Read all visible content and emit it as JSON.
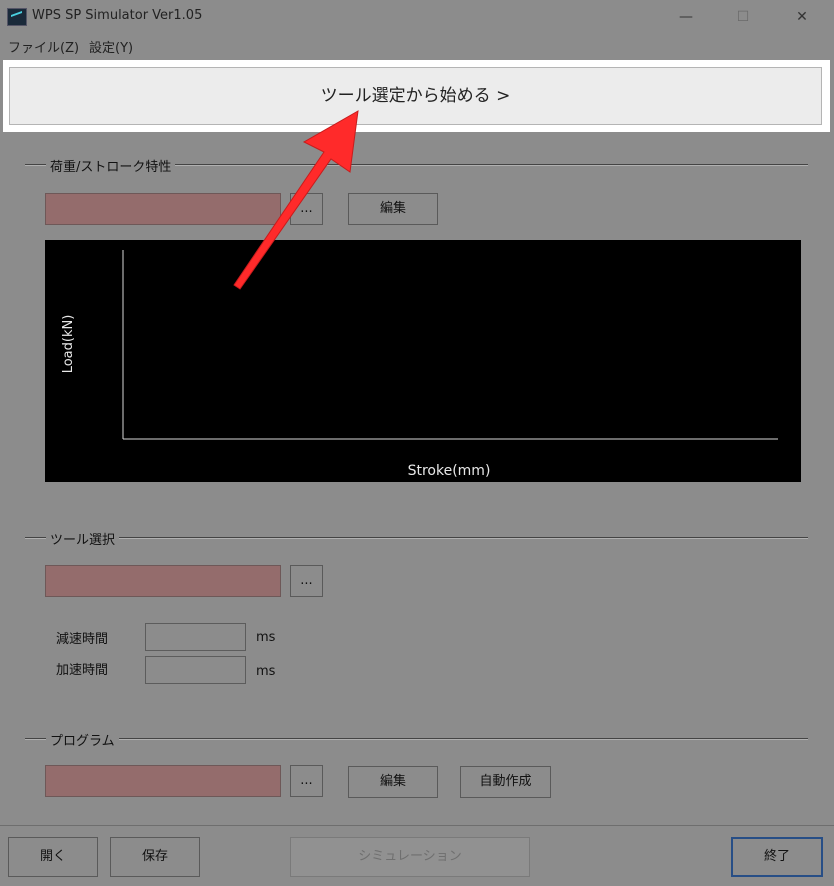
{
  "window": {
    "title": "WPS SP Simulator  Ver1.05",
    "minimize_glyph": "—",
    "maximize_glyph": "☐",
    "close_glyph": "✕"
  },
  "menu": {
    "file": "ファイル(Z)",
    "settings": "設定(Y)"
  },
  "start": {
    "label": "ツール選定から始める >"
  },
  "load_stroke": {
    "group_label": "荷重/ストローク特性",
    "browse_label": "...",
    "edit_label": "編集",
    "chart_data": {
      "type": "line",
      "xlabel": "Stroke(mm)",
      "ylabel": "Load(kN)",
      "series": []
    }
  },
  "tool": {
    "group_label": "ツール選択",
    "browse_label": "...",
    "decel_label": "減速時間",
    "decel_unit": "ms",
    "decel_value": "",
    "accel_label": "加速時間",
    "accel_unit": "ms",
    "accel_value": ""
  },
  "program": {
    "group_label": "プログラム",
    "browse_label": "...",
    "edit_label": "編集",
    "auto_label": "自動作成"
  },
  "footer": {
    "open_label": "開く",
    "save_label": "保存",
    "simulate_label": "シミュレーション",
    "exit_label": "終了"
  },
  "colors": {
    "annotation_arrow": "#ff2a2a",
    "field_pink": "#946c6c",
    "accent_border": "#274e86"
  }
}
